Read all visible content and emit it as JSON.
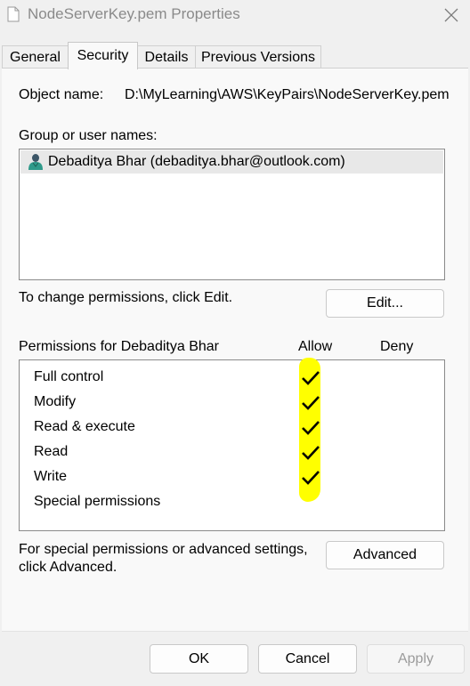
{
  "window": {
    "title": "NodeServerKey.pem Properties"
  },
  "tabs": [
    {
      "label": "General"
    },
    {
      "label": "Security"
    },
    {
      "label": "Details"
    },
    {
      "label": "Previous Versions"
    }
  ],
  "security": {
    "object_name_label": "Object name:",
    "object_name_value": "D:\\MyLearning\\AWS\\KeyPairs\\NodeServerKey.pem",
    "group_label": "Group or user names:",
    "users": [
      {
        "name": "Debaditya Bhar (debaditya.bhar@outlook.com)"
      }
    ],
    "change_hint": "To change permissions, click Edit.",
    "edit_button": "Edit...",
    "permissions_for_label": "Permissions for Debaditya Bhar",
    "allow_header": "Allow",
    "deny_header": "Deny",
    "permissions": [
      {
        "name": "Full control",
        "allow": true,
        "deny": false
      },
      {
        "name": "Modify",
        "allow": true,
        "deny": false
      },
      {
        "name": "Read & execute",
        "allow": true,
        "deny": false
      },
      {
        "name": "Read",
        "allow": true,
        "deny": false
      },
      {
        "name": "Write",
        "allow": true,
        "deny": false
      },
      {
        "name": "Special permissions",
        "allow": false,
        "deny": false
      }
    ],
    "advanced_hint_line1": "For special permissions or advanced settings,",
    "advanced_hint_line2": "click Advanced.",
    "advanced_button": "Advanced",
    "highlight_color": "#ffff00"
  },
  "footer": {
    "ok": "OK",
    "cancel": "Cancel",
    "apply": "Apply"
  }
}
